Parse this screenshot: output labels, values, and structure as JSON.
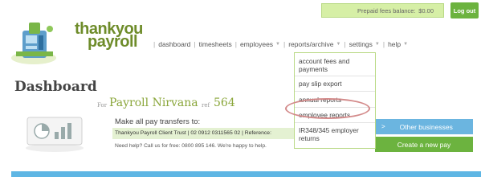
{
  "header": {
    "balance_label": "Prepaid fees balance:",
    "balance_value": "$0.00",
    "logout_label": "Log out"
  },
  "logo": {
    "line1": "thankyou",
    "line2": "payroll"
  },
  "nav": {
    "items": [
      {
        "label": "dashboard",
        "has_caret": false
      },
      {
        "label": "timesheets",
        "has_caret": false
      },
      {
        "label": "employees",
        "has_caret": true
      },
      {
        "label": "reports/archive",
        "has_caret": true
      },
      {
        "label": "settings",
        "has_caret": true
      },
      {
        "label": "help",
        "has_caret": true
      }
    ],
    "caret_icon": "chevron-down-icon"
  },
  "dropdown": {
    "items": [
      "account fees and payments",
      "pay slip export",
      "annual reports",
      "employee reports",
      "IR348/345 employer returns"
    ],
    "highlighted": "employee reports",
    "highlight_color": "#d38a8a"
  },
  "dashboard": {
    "title": "Dashboard",
    "for_label": "For",
    "company": "Payroll Nirvana",
    "ref_label": "ref",
    "ref_number": "564",
    "pay_heading": "Make all pay transfers to:",
    "trust_line": "Thankyou Payroll Client Trust | 02 0912 0311565 02 | Reference:",
    "help_text": "Need help? Call us for free: 0800 895 146. We're happy to help."
  },
  "actions": {
    "other_label": "Other businesses",
    "create_label": "Create a new pay"
  },
  "colors": {
    "brand_green": "#6cb33f",
    "accent_blue": "#6bb5e0",
    "balance_bg": "#d6efa6"
  }
}
